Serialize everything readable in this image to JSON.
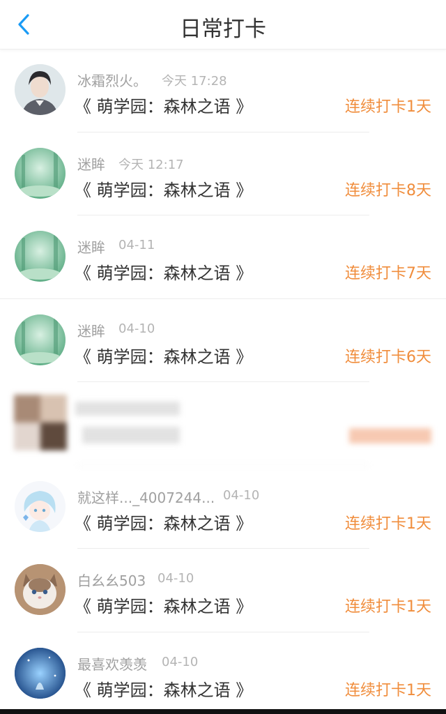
{
  "header": {
    "title": "日常打卡",
    "back_icon": "chevron-left-icon",
    "accent": "#1a9bf5"
  },
  "colors": {
    "streak": "#f08d3c"
  },
  "checkins": [
    {
      "user": "冰霜烈火。",
      "time": "今天 17:28",
      "book": "《 萌学园：森林之语 》",
      "streak": "连续打卡1天",
      "avatar": "portrait-avatar"
    },
    {
      "user": "迷眸",
      "time": "今天 12:17",
      "book": "《 萌学园：森林之语 》",
      "streak": "连续打卡8天",
      "avatar": "forest-avatar"
    },
    {
      "user": "迷眸",
      "time": "04-11",
      "book": "《 萌学园：森林之语 》",
      "streak": "连续打卡7天",
      "avatar": "forest-avatar"
    },
    {
      "user": "迷眸",
      "time": "04-10",
      "book": "《 萌学园：森林之语 》",
      "streak": "连续打卡6天",
      "avatar": "forest-avatar"
    },
    {
      "blurred": true,
      "avatar": "blurred-avatar"
    },
    {
      "user": "就这样..._4007244...",
      "time": "04-10",
      "book": "《 萌学园：森林之语 》",
      "streak": "连续打卡1天",
      "avatar": "anime-girl-avatar"
    },
    {
      "user": "白幺幺503",
      "time": "04-10",
      "book": "《 萌学园：森林之语 》",
      "streak": "连续打卡1天",
      "avatar": "kitten-avatar"
    },
    {
      "user": "最喜欢羡羡",
      "time": "04-10",
      "book": "《 萌学园：森林之语 》",
      "streak": "连续打卡1天",
      "avatar": "blue-night-avatar"
    }
  ]
}
